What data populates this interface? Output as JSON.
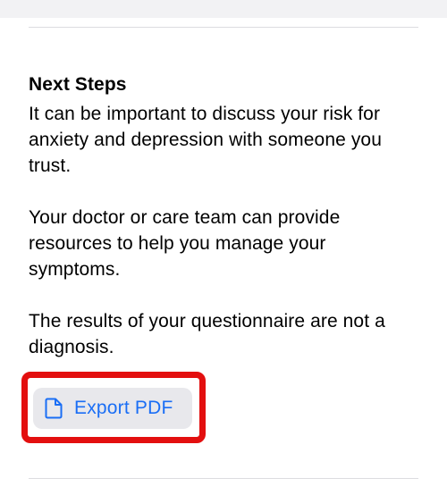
{
  "next_steps": {
    "heading": "Next Steps",
    "paragraphs": [
      "It can be important to discuss your risk for anxiety and depression with someone you trust.",
      "Your doctor or care team can provide resources to help you manage your symptoms.",
      "The results of your questionnaire are not a diagnosis."
    ]
  },
  "export": {
    "label": "Export PDF",
    "icon": "document-icon",
    "highlighted": true
  },
  "colors": {
    "accent": "#1a6ef5",
    "button_background": "#e8e8ec",
    "highlight": "#e30f0f",
    "divider": "#dcdce0"
  }
}
